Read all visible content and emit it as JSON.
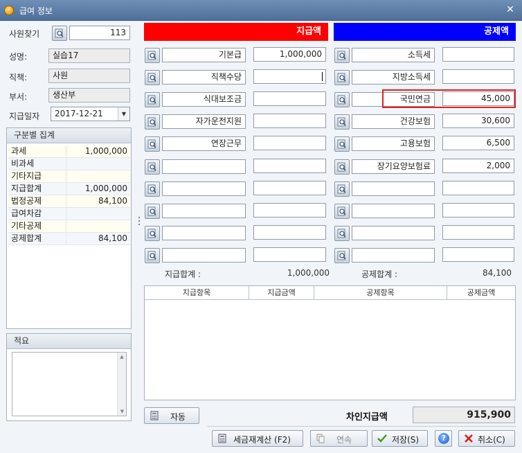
{
  "window": {
    "title": "급여 정보"
  },
  "employee": {
    "search_label": "사원찾기",
    "search_value": "113",
    "name_label": "성명:",
    "name_value": "실습17",
    "position_label": "직책:",
    "position_value": "사원",
    "dept_label": "부서:",
    "dept_value": "생산부",
    "paydate_label": "지급일자",
    "paydate_value": "2017-12-21"
  },
  "summary": {
    "title": "구분별 집계",
    "rows": [
      {
        "label": "과세",
        "value": "1,000,000"
      },
      {
        "label": "비과세",
        "value": ""
      },
      {
        "label": "기타지급",
        "value": ""
      },
      {
        "label": "지급합계",
        "value": "1,000,000"
      },
      {
        "label": "법정공제",
        "value": "84,100"
      },
      {
        "label": "급여차감",
        "value": ""
      },
      {
        "label": "기타공제",
        "value": ""
      },
      {
        "label": "공제합계",
        "value": "84,100"
      }
    ]
  },
  "memo": {
    "title": "적요",
    "value": ""
  },
  "payments": {
    "header": "지급액",
    "items": [
      {
        "name": "기본급",
        "amount": "1,000,000"
      },
      {
        "name": "직책수당",
        "amount": ""
      },
      {
        "name": "식대보조금",
        "amount": ""
      },
      {
        "name": "자가운전지원",
        "amount": ""
      },
      {
        "name": "연장근무",
        "amount": ""
      },
      {
        "name": "",
        "amount": ""
      },
      {
        "name": "",
        "amount": ""
      },
      {
        "name": "",
        "amount": ""
      },
      {
        "name": "",
        "amount": ""
      },
      {
        "name": "",
        "amount": ""
      }
    ],
    "total_label": "지급합계 :",
    "total_value": "1,000,000"
  },
  "deductions": {
    "header": "공제액",
    "items": [
      {
        "name": "소득세",
        "amount": ""
      },
      {
        "name": "지방소득세",
        "amount": ""
      },
      {
        "name": "국민연금",
        "amount": "45,000"
      },
      {
        "name": "건강보험",
        "amount": "30,600"
      },
      {
        "name": "고용보험",
        "amount": "6,500"
      },
      {
        "name": "장기요양보험료",
        "amount": "2,000"
      },
      {
        "name": "",
        "amount": ""
      },
      {
        "name": "",
        "amount": ""
      },
      {
        "name": "",
        "amount": ""
      },
      {
        "name": "",
        "amount": ""
      }
    ],
    "total_label": "공제합계 :",
    "total_value": "84,100"
  },
  "grid": {
    "columns": [
      "지급항목",
      "지급금액",
      "공제항목",
      "공제금액"
    ]
  },
  "footer": {
    "auto_button": "자동",
    "net_pay_label": "차인지급액",
    "net_pay_value": "915,900",
    "recalc_button": "세금재계산 (F2)",
    "continue_button": "연속",
    "save_button": "저장(S)",
    "help_button": "?",
    "cancel_button": "취소(C)"
  },
  "colors": {
    "pay_header": "#ff0000",
    "deduction_header": "#0000ff",
    "highlight": "#e02020"
  }
}
